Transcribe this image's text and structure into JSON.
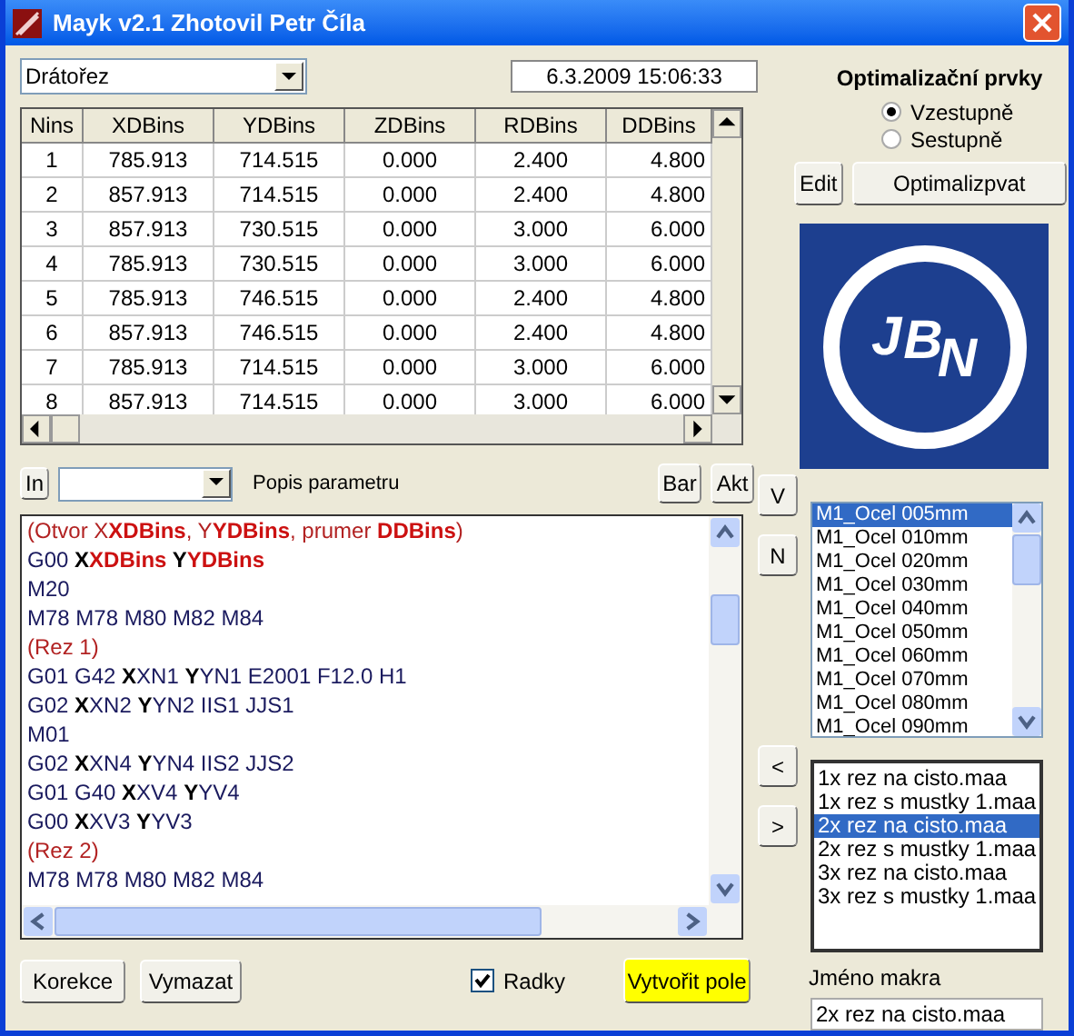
{
  "window": {
    "title": "Mayk v2.1 Zhotovil Petr Číla"
  },
  "machine_select": {
    "value": "Drátořez"
  },
  "datetime": "6.3.2009 15:06:33",
  "table": {
    "columns": [
      "Nins",
      "XDBins",
      "YDBins",
      "ZDBins",
      "RDBins",
      "DDBins"
    ],
    "rows": [
      [
        "1",
        "785.913",
        "714.515",
        "0.000",
        "2.400",
        "4.800"
      ],
      [
        "2",
        "857.913",
        "714.515",
        "0.000",
        "2.400",
        "4.800"
      ],
      [
        "3",
        "857.913",
        "730.515",
        "0.000",
        "3.000",
        "6.000"
      ],
      [
        "4",
        "785.913",
        "730.515",
        "0.000",
        "3.000",
        "6.000"
      ],
      [
        "5",
        "785.913",
        "746.515",
        "0.000",
        "2.400",
        "4.800"
      ],
      [
        "6",
        "857.913",
        "746.515",
        "0.000",
        "2.400",
        "4.800"
      ],
      [
        "7",
        "785.913",
        "714.515",
        "0.000",
        "3.000",
        "6.000"
      ],
      [
        "8",
        "857.913",
        "714.515",
        "0.000",
        "3.000",
        "6.000"
      ]
    ]
  },
  "param_bar": {
    "in_button": "In",
    "param_label": "Popis parametru",
    "bar_button": "Bar",
    "akt_button": "Akt"
  },
  "editor_lines": [
    [
      {
        "kind": "comment",
        "text": "(Otvor X"
      },
      {
        "kind": "var",
        "text": "XDBins"
      },
      {
        "kind": "comment",
        "text": ", Y"
      },
      {
        "kind": "var",
        "text": "YDBins"
      },
      {
        "kind": "comment",
        "text": ", prumer "
      },
      {
        "kind": "var",
        "text": "DDBins"
      },
      {
        "kind": "comment",
        "text": ")"
      }
    ],
    [
      {
        "kind": "code",
        "text": "G00 "
      },
      {
        "kind": "addr",
        "text": "X"
      },
      {
        "kind": "var",
        "text": "XDBins"
      },
      {
        "kind": "addr",
        "text": " Y"
      },
      {
        "kind": "var",
        "text": "YDBins"
      }
    ],
    [
      {
        "kind": "code",
        "text": "M20"
      }
    ],
    [
      {
        "kind": "code",
        "text": "M78 M78 M80 M82 M84"
      }
    ],
    [
      {
        "kind": "comment",
        "text": "(Rez 1)"
      }
    ],
    [
      {
        "kind": "code",
        "text": "G01 G42 "
      },
      {
        "kind": "addr",
        "text": "X"
      },
      {
        "kind": "code",
        "text": "XN1 "
      },
      {
        "kind": "addr",
        "text": "Y"
      },
      {
        "kind": "code",
        "text": "YN1 E2001 F12.0 H1"
      }
    ],
    [
      {
        "kind": "code",
        "text": "G02 "
      },
      {
        "kind": "addr",
        "text": "X"
      },
      {
        "kind": "code",
        "text": "XN2 "
      },
      {
        "kind": "addr",
        "text": "Y"
      },
      {
        "kind": "code",
        "text": "YN2 IIS1 JJS1"
      }
    ],
    [
      {
        "kind": "code",
        "text": "M01"
      }
    ],
    [
      {
        "kind": "code",
        "text": "G02 "
      },
      {
        "kind": "addr",
        "text": "X"
      },
      {
        "kind": "code",
        "text": "XN4 "
      },
      {
        "kind": "addr",
        "text": "Y"
      },
      {
        "kind": "code",
        "text": "YN4 IIS2 JJS2"
      }
    ],
    [
      {
        "kind": "code",
        "text": "G01 G40 "
      },
      {
        "kind": "addr",
        "text": "X"
      },
      {
        "kind": "code",
        "text": "XV4 "
      },
      {
        "kind": "addr",
        "text": "Y"
      },
      {
        "kind": "code",
        "text": "YV4"
      }
    ],
    [
      {
        "kind": "code",
        "text": "G00 "
      },
      {
        "kind": "addr",
        "text": "X"
      },
      {
        "kind": "code",
        "text": "XV3 "
      },
      {
        "kind": "addr",
        "text": "Y"
      },
      {
        "kind": "code",
        "text": "YV3"
      }
    ],
    [
      {
        "kind": "comment",
        "text": "(Rez 2)"
      }
    ],
    [
      {
        "kind": "code",
        "text": "M78 M78 M80 M82 M84"
      }
    ]
  ],
  "bottom": {
    "korekce": "Korekce",
    "vymazat": "Vymazat",
    "radky": {
      "label": "Radky",
      "checked": true
    },
    "create": "Vytvořit pole"
  },
  "optimization": {
    "title": "Optimalizační prvky",
    "options": [
      {
        "label": "Vzestupně",
        "selected": true
      },
      {
        "label": "Sestupně",
        "selected": false
      }
    ],
    "edit_button": "Edit",
    "optimize_button": "Optimalizpvat"
  },
  "logo": {
    "letters": [
      "J",
      "B",
      "N"
    ]
  },
  "v_button": "V",
  "n_button": "N",
  "left_button": "<",
  "right_button": ">",
  "materials": [
    {
      "label": "M1_Ocel 005mm",
      "selected": true
    },
    {
      "label": "M1_Ocel 010mm",
      "selected": false
    },
    {
      "label": "M1_Ocel 020mm",
      "selected": false
    },
    {
      "label": "M1_Ocel 030mm",
      "selected": false
    },
    {
      "label": "M1_Ocel 040mm",
      "selected": false
    },
    {
      "label": "M1_Ocel 050mm",
      "selected": false
    },
    {
      "label": "M1_Ocel 060mm",
      "selected": false
    },
    {
      "label": "M1_Ocel 070mm",
      "selected": false
    },
    {
      "label": "M1_Ocel 080mm",
      "selected": false
    },
    {
      "label": "M1_Ocel 090mm",
      "selected": false
    }
  ],
  "macros": [
    {
      "label": "1x rez na cisto.maa",
      "selected": false
    },
    {
      "label": "1x rez s mustky 1.maa",
      "selected": false
    },
    {
      "label": "2x rez na cisto.maa",
      "selected": true
    },
    {
      "label": "2x rez s mustky 1.maa",
      "selected": false
    },
    {
      "label": "3x rez na cisto.maa",
      "selected": false
    },
    {
      "label": "3x rez s mustky 1.maa",
      "selected": false
    }
  ],
  "macro_name": {
    "label": "Jméno makra",
    "value": "2x rez na cisto.maa"
  }
}
